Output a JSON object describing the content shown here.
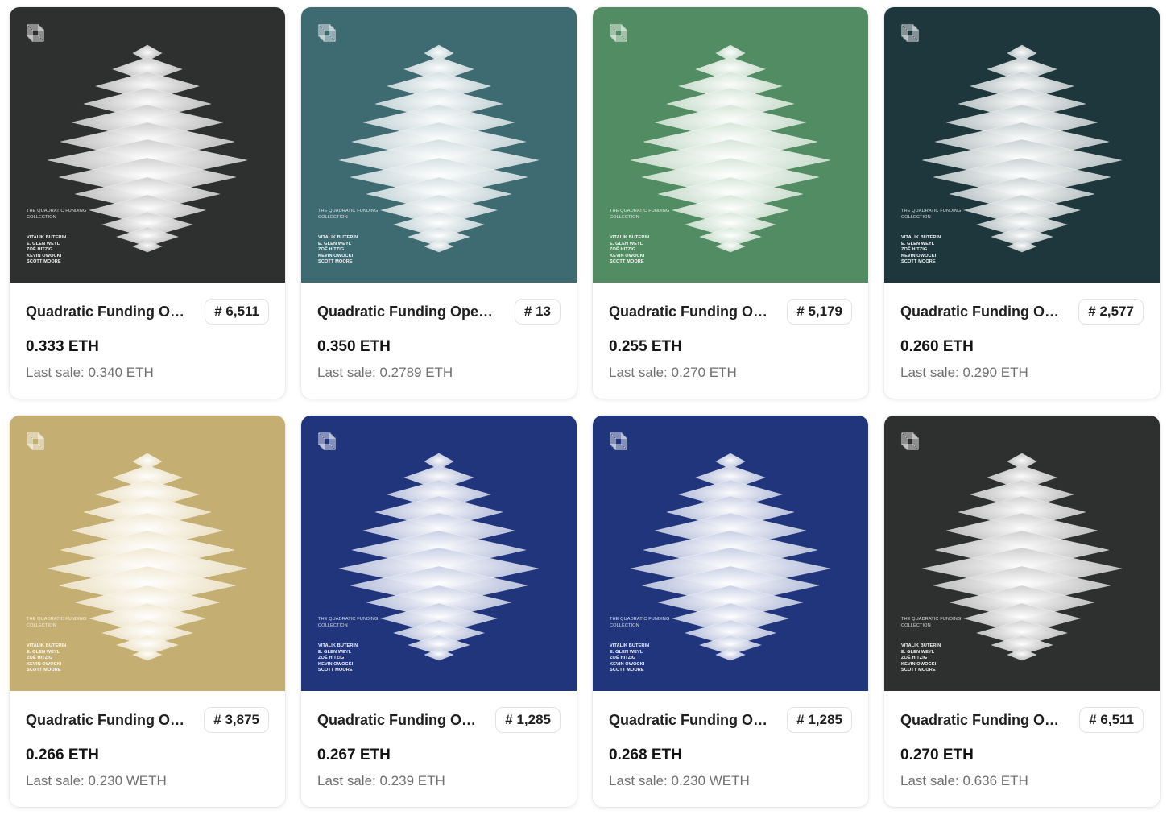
{
  "art": {
    "collection_text": "THE QUADRATIC FUNDING COLLECTION",
    "authors": [
      "VITALIK BUTERIN",
      "E. GLEN WEYL",
      "ZOË HITZIG",
      "KEVIN OWOCKI",
      "SCOTT MOORE"
    ]
  },
  "cards": [
    {
      "title": "Quadratic Funding Open Edition",
      "badge": "# 6,511",
      "price": "0.333 ETH",
      "last_sale": "Last sale: 0.340 ETH",
      "bg": "#2d302f",
      "tint": "#bdbdbd"
    },
    {
      "title": "Quadratic Funding Open Edition",
      "badge": "# 13",
      "price": "0.350 ETH",
      "last_sale": "Last sale: 0.2789 ETH",
      "bg": "#3e6a72",
      "tint": "#c3d3d6"
    },
    {
      "title": "Quadratic Funding Open Edition",
      "badge": "# 5,179",
      "price": "0.255 ETH",
      "last_sale": "Last sale: 0.270 ETH",
      "bg": "#528c62",
      "tint": "#c6dcc9"
    },
    {
      "title": "Quadratic Funding Open Edition",
      "badge": "# 2,577",
      "price": "0.260 ETH",
      "last_sale": "Last sale: 0.290 ETH",
      "bg": "#1e373c",
      "tint": "#b4bfc1"
    },
    {
      "title": "Quadratic Funding Open Edition",
      "badge": "# 3,875",
      "price": "0.266 ETH",
      "last_sale": "Last sale: 0.230 WETH",
      "bg": "#c4ae71",
      "tint": "#ebdfbf"
    },
    {
      "title": "Quadratic Funding Open Edition",
      "badge": "# 1,285",
      "price": "0.267 ETH",
      "last_sale": "Last sale: 0.239 ETH",
      "bg": "#21357d",
      "tint": "#b3bddc"
    },
    {
      "title": "Quadratic Funding Open Edition",
      "badge": "# 1,285",
      "price": "0.268 ETH",
      "last_sale": "Last sale: 0.230 WETH",
      "bg": "#21357d",
      "tint": "#b3bddc"
    },
    {
      "title": "Quadratic Funding Open Edition",
      "badge": "# 6,511",
      "price": "0.270 ETH",
      "last_sale": "Last sale: 0.636 ETH",
      "bg": "#2d302f",
      "tint": "#bdbdbd"
    }
  ]
}
